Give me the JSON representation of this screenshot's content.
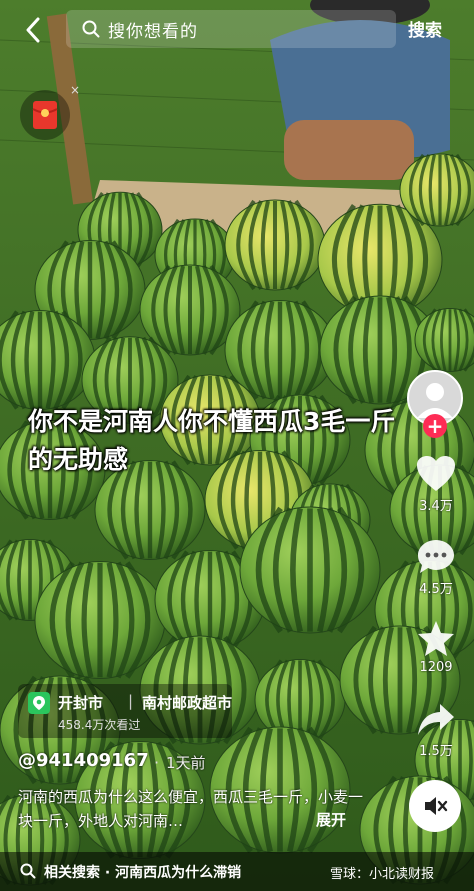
{
  "search": {
    "placeholder": "搜你想看的",
    "button": "搜索"
  },
  "caption": "你不是河南人你不懂西瓜3毛一斤的无助感",
  "rail": {
    "likes": "3.4万",
    "comments": "4.5万",
    "favorites": "1209",
    "shares": "1.5万"
  },
  "location": {
    "city": "开封市",
    "separator": "|",
    "poi": "南村邮政超市",
    "views": "458.4万次看过"
  },
  "author": "@941409167",
  "time": "1天前",
  "description": "河南的西瓜为什么这么便宜，西瓜三毛一斤，小麦一块一斤，外地人对河南…",
  "expand": "展开",
  "related": "相关搜索 · 河南西瓜为什么滞销",
  "watermark": "雪球：小北读财报",
  "colors": {
    "like": "#ffffff",
    "follow": "#fe2c55",
    "location_pin": "#2bc55d"
  },
  "icons": [
    "back-icon",
    "search-icon",
    "red-packet-icon",
    "heart-icon",
    "comment-icon",
    "star-icon",
    "share-icon",
    "mute-icon",
    "location-pin-icon"
  ]
}
